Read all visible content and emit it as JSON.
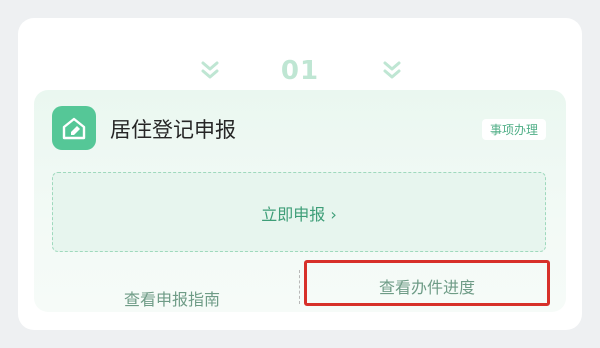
{
  "step": {
    "number": "01"
  },
  "service": {
    "title": "居住登记申报",
    "tag": "事项办理",
    "icon": "house-edit-icon",
    "accent_color": "#55c797"
  },
  "actions": {
    "apply_label": "立即申报 ›",
    "guide_label": "查看申报指南",
    "progress_label": "查看办件进度"
  },
  "highlight_color": "#d7302a"
}
